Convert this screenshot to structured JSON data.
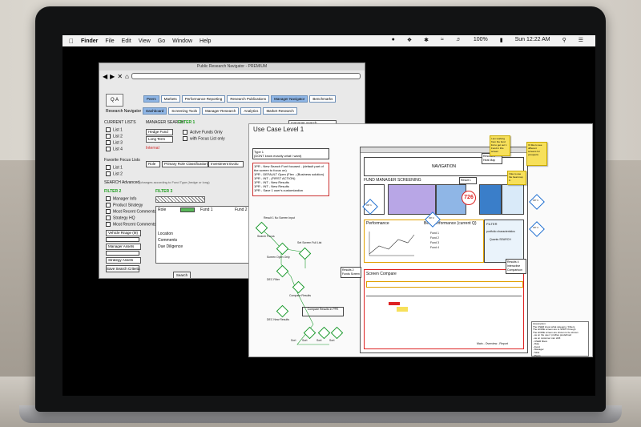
{
  "menubar": {
    "apple_icon": "apple-icon",
    "items": [
      "Finder",
      "File",
      "Edit",
      "View",
      "Go",
      "Window",
      "Help"
    ],
    "battery": "100%",
    "clock": "Sun 12:22 AM"
  },
  "research_window": {
    "title": "Public Research Navigator - PREMIUM",
    "logo": "Q A",
    "top_tabs": [
      "Peers",
      "Markets",
      "Performance Reporting",
      "Research Publications",
      "Manager Navigator",
      "Benchmarks"
    ],
    "sub_label": "Research Navigator",
    "sub_tabs": [
      "Dashboard",
      "Screening Tools",
      "Manager Research",
      "Analytics",
      "Market Research"
    ],
    "current_lists": "CURRENT LISTS",
    "lists": [
      "List 1",
      "List 2",
      "List 3",
      "List 4"
    ],
    "manager_search": "MANAGER SEARCH",
    "filter1": "FILTER 1",
    "search_field": "manager search",
    "hedge": "Hedge Fund",
    "longterm": "Long Term",
    "active_only": "Active Funds Only",
    "with_focus": "with Focus List only",
    "internal": "Internal",
    "fav_focus": "Favorite Focus Lists",
    "fav_lists": [
      "List 1",
      "List 2"
    ],
    "role": "Role",
    "primary_role": "Primary Role Classification",
    "investment": "Investment Evolu",
    "search_adv": "SEARCH Advanced",
    "search_adv_hint": "(changes according to Fund Type (hedge or long)",
    "filter2": "FILTER 2",
    "filter3": "FILTER 3",
    "filter2_items": [
      "Manager Info",
      "Product Strategy",
      "Most Recent Comments",
      "Strategy HQ",
      "Most Recent Comments"
    ],
    "vehicle": "Vehicle Rnage (M)",
    "mgr_assets": "Manager Assets",
    "strat_assets": "Strategy Assets",
    "save_btn": "Save Search Criteria",
    "search_btn": "Search",
    "grid_headers": [
      "Role",
      "Fund 1",
      "Fund 2"
    ],
    "grid_rows": [
      "Location",
      "Comments",
      "Due Diligence"
    ]
  },
  "usecase_window": {
    "title": "Use Case Level 1",
    "type_note": "Type 1\n(DONT know exactly what I want)",
    "left_note": "1PR - New Search Funt focused - (default part of the screen to focus on)\n1PR - DEFAULT Open (Flex - (Business solution)\n1PR - INT - (FIRST ACTION)\n1PR - INT - New Results\n1PR - INT - New Results\n1PR - Save 1 user's customization",
    "flow_labels": [
      "Result 1 No Screen Input",
      "Search Focus",
      "Screen Open Only",
      "Set Screen Full List",
      "Compare Results",
      "DEC Filter",
      "DEC New Results",
      "Compare Results in PPE",
      "Sort",
      "Sort",
      "Sort",
      "Sort"
    ],
    "nav": "NAVIGATION",
    "fund_screening": "FUND MANAGER SCREENING",
    "performance": "Performance",
    "best_perf": "Best Performance (current Q)",
    "screen_compare": "Screen Compare",
    "filter_label": "FILTER",
    "filter_desc": "portfolio characteristics",
    "quant_search": "Quants SEARCH",
    "badge": "726",
    "op_labels": [
      "OP 1",
      "OP 2",
      "OP 3",
      "OP 4",
      "OP 5",
      "OP 6"
    ],
    "result_notes": [
      "Result 1",
      "Results 2 Funds Screen",
      "Results 3 Heat Map",
      "Results 4 Interactive Comparison"
    ],
    "legend": [
      "Fund 1",
      "Fund 2",
      "Fund 3",
      "Fund 4"
    ],
    "footer_note": "Main - Overview - Report",
    "stickies": [
      "I am working from the fund list to get out 1 Fund in this screen",
      "I'd like to see different screens for prospects",
      "I like to use the heat map in"
    ],
    "right_note": "Assumption:\nThe USER know what category / Filters\nThe HOME screen are to SORT through\nThe HOME screen are shown to be shown\n- as on the user / profiles predefined\n- as on customer can shift\n- USER filters\n- Role\n- Fund\n- Manager\n- Strat\n- Peers"
  }
}
